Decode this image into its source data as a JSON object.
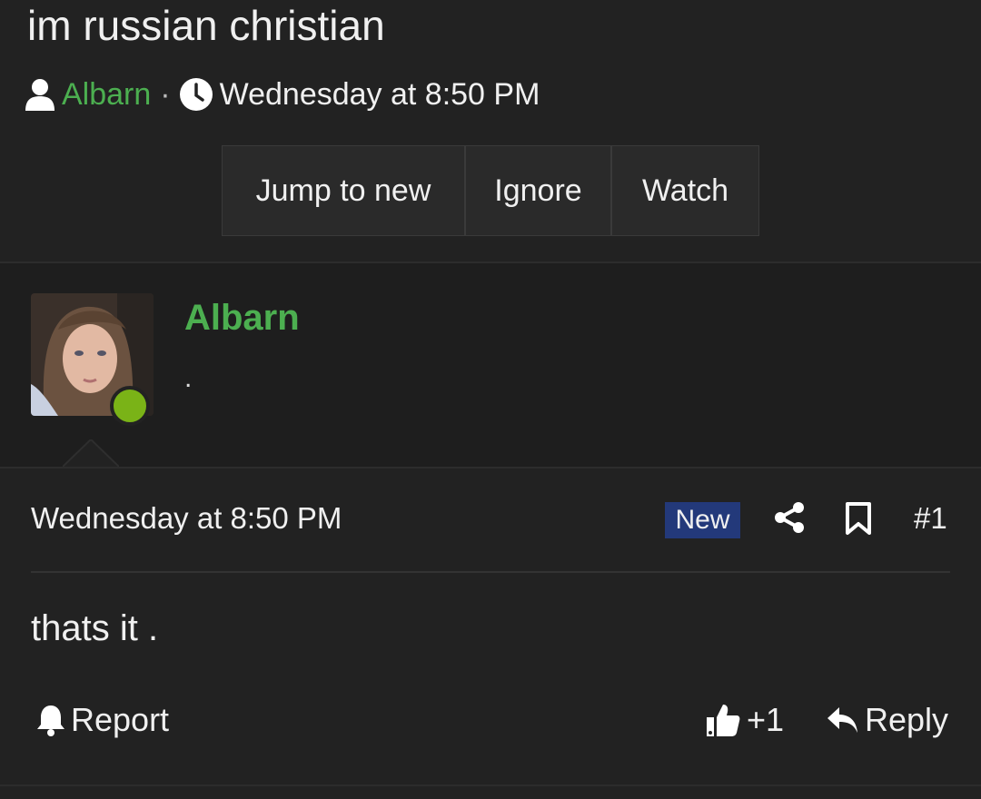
{
  "thread": {
    "title": "im russian christian",
    "author": "Albarn",
    "separator": "·",
    "date": "Wednesday at 8:50 PM",
    "buttons": {
      "jump": "Jump to new",
      "ignore": "Ignore",
      "watch": "Watch"
    }
  },
  "post": {
    "username": "Albarn",
    "user_title": ".",
    "date": "Wednesday at 8:50 PM",
    "badge": "New",
    "number": "#1",
    "text": "thats it .",
    "actions": {
      "report": "Report",
      "like_count": "+1",
      "reply": "Reply"
    }
  },
  "colors": {
    "accent_green": "#4caf50",
    "online": "#7ab317",
    "badge_bg": "#23397a"
  },
  "icons": [
    "user-icon",
    "clock-icon",
    "share-icon",
    "bookmark-icon",
    "bell-icon",
    "thumbs-up-icon",
    "reply-icon"
  ]
}
